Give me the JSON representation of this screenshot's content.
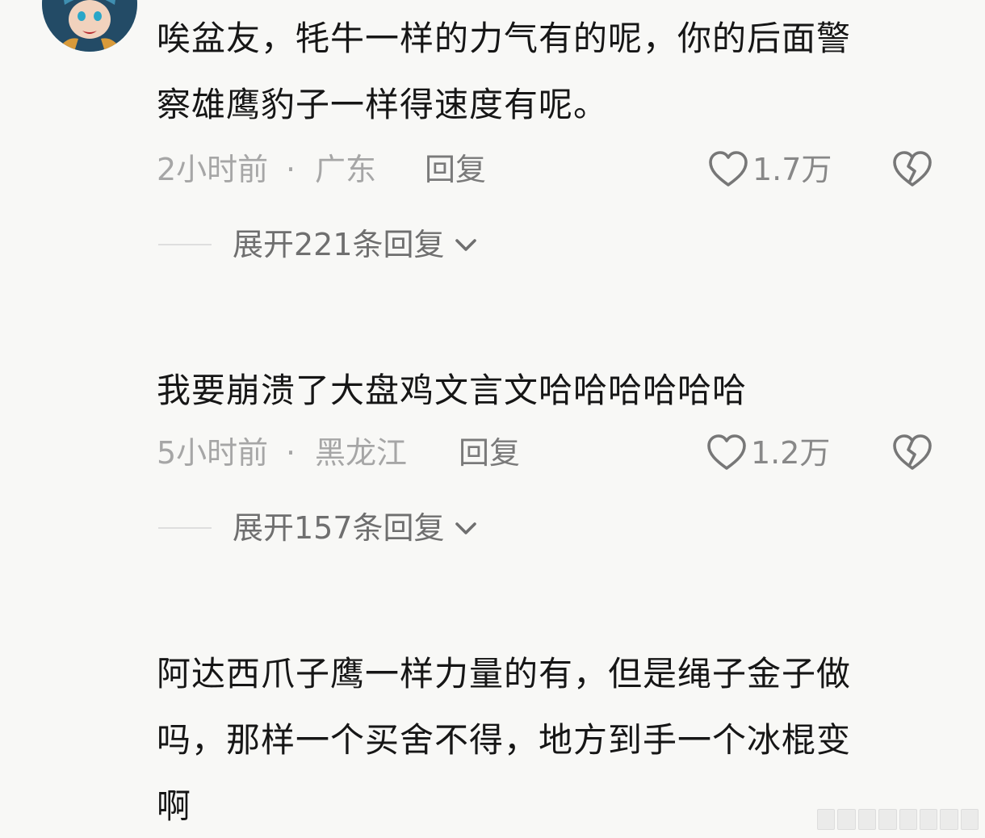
{
  "comments": [
    {
      "text_line1": "唉盆友，牦牛一样的力气有的呢，你的后面警",
      "text_line2": "察雄鹰豹子一样得速度有呢。",
      "time": "2小时前",
      "dot": "·",
      "region": "广东",
      "reply_label": "回复",
      "likes": "1.7万",
      "expand_label": "展开221条回复"
    },
    {
      "text_line1": "我要崩溃了大盘鸡文言文哈哈哈哈哈哈",
      "time": "5小时前",
      "dot": "·",
      "region": "黑龙江",
      "reply_label": "回复",
      "likes": "1.2万",
      "expand_label": "展开157条回复"
    },
    {
      "text_line1": "阿达西爪子鹰一样力量的有，但是绳子金子做",
      "text_line2": "吗，那样一个买舍不得，地方到手一个冰棍变",
      "text_line3": "啊"
    }
  ],
  "icons": {
    "like": "heart-outline-icon",
    "dislike": "broken-heart-icon",
    "expand": "chevron-down-icon"
  },
  "colors": {
    "background": "#f8f8f6",
    "text": "#161616",
    "meta": "#a6a6a6",
    "reply": "#7a7a7a"
  }
}
